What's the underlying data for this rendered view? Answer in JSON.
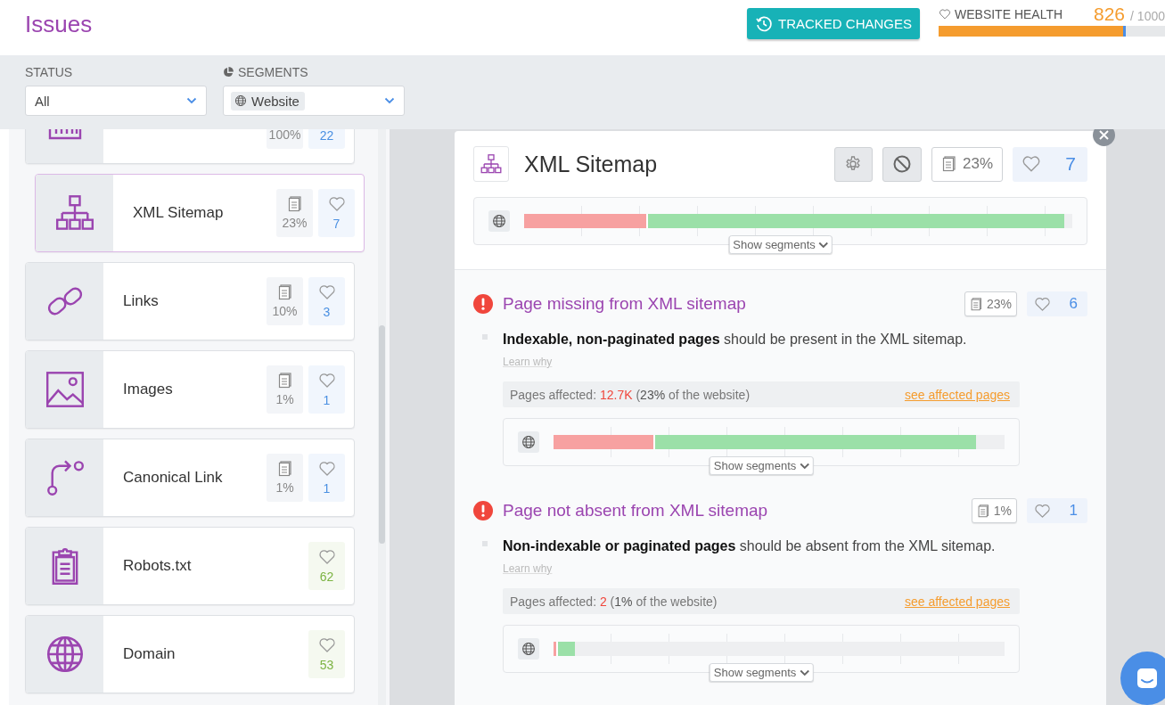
{
  "header": {
    "title": "Issues",
    "tracked_changes_button": "TRACKED CHANGES",
    "health": {
      "label": "WEBSITE HEALTH",
      "score": "826",
      "total": "/ 1000",
      "level": 0.826
    }
  },
  "filters": {
    "status": {
      "label": "STATUS",
      "value": "All"
    },
    "segments": {
      "label": "SEGMENTS",
      "value": "Website"
    }
  },
  "categories": [
    {
      "kind": "analytics",
      "pages": "100%",
      "count": "22",
      "color": "#4a90e2",
      "selected": false
    },
    {
      "kind": "sitemap",
      "name": "XML Sitemap",
      "pages": "23%",
      "count": "7",
      "color": "#4a90e2",
      "selected": true
    },
    {
      "kind": "link",
      "name": "Links",
      "pages": "10%",
      "count": "3",
      "color": "#4a90e2",
      "selected": false
    },
    {
      "kind": "image",
      "name": "Images",
      "pages": "1%",
      "count": "1",
      "color": "#4a90e2",
      "selected": false
    },
    {
      "kind": "canonical",
      "name": "Canonical Link",
      "pages": "1%",
      "count": "1",
      "color": "#4a90e2",
      "selected": false
    },
    {
      "kind": "clipboard",
      "name": "Robots.txt",
      "count": "62",
      "color": "#7cb342",
      "selected": false
    },
    {
      "kind": "globe",
      "name": "Domain",
      "count": "53",
      "color": "#7cb342",
      "selected": false
    }
  ],
  "detail": {
    "kind": "sitemap",
    "title": "XML Sitemap",
    "pages": "23%",
    "count": "7",
    "bar": {
      "segments": [
        {
          "kind": "error",
          "level": 0.226
        },
        {
          "kind": "ok",
          "level": 0.986
        }
      ],
      "button": "Show segments"
    },
    "issues": [
      {
        "title": "Page missing from XML sitemap",
        "pages": "23%",
        "count": "6",
        "description": "**Indexable, non-paginated pages** should be present in the XML sitemap.",
        "learn_why": "Learn why",
        "affected": {
          "label": "Pages affected:",
          "value": "12.7K",
          "share": "(**23%** of the website)"
        },
        "link": "see affected pages",
        "bar": {
          "segments": [
            {
              "kind": "error",
              "level": 0.226
            },
            {
              "kind": "ok",
              "level": 0.936
            }
          ],
          "button": "Show segments"
        }
      },
      {
        "title": "Page not absent from XML sitemap",
        "pages": "1%",
        "count": "1",
        "description": "**Non-indexable or paginated pages** should be absent from the XML sitemap.",
        "learn_why": "Learn why",
        "affected": {
          "label": "Pages affected:",
          "value": "2",
          "share": "(**1%** of the website)"
        },
        "link": "see affected pages",
        "bar": {
          "segments": [
            {
              "kind": "error",
              "level": 0.01
            },
            {
              "kind": "ok",
              "level": 0.047
            }
          ],
          "button": "Show segments"
        }
      }
    ]
  }
}
